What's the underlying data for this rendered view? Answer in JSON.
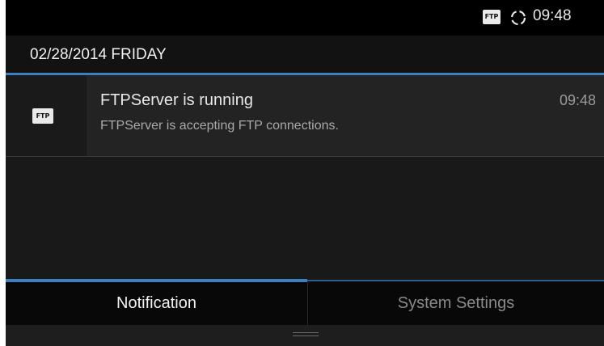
{
  "status_bar": {
    "ftp_badge": "FTP",
    "time": "09:48",
    "icons": [
      "ftp-icon",
      "sync-icon"
    ]
  },
  "date_header": {
    "text": "02/28/2014 FRIDAY"
  },
  "notification": {
    "icon_label": "FTP",
    "title": "FTPServer is running",
    "text": "FTPServer is accepting FTP connections.",
    "time": "09:48"
  },
  "tabs": [
    {
      "label": "Notification",
      "active": true
    },
    {
      "label": "System Settings",
      "active": false
    }
  ],
  "colors": {
    "accent": "#3d7fc2",
    "background": "#111111"
  }
}
